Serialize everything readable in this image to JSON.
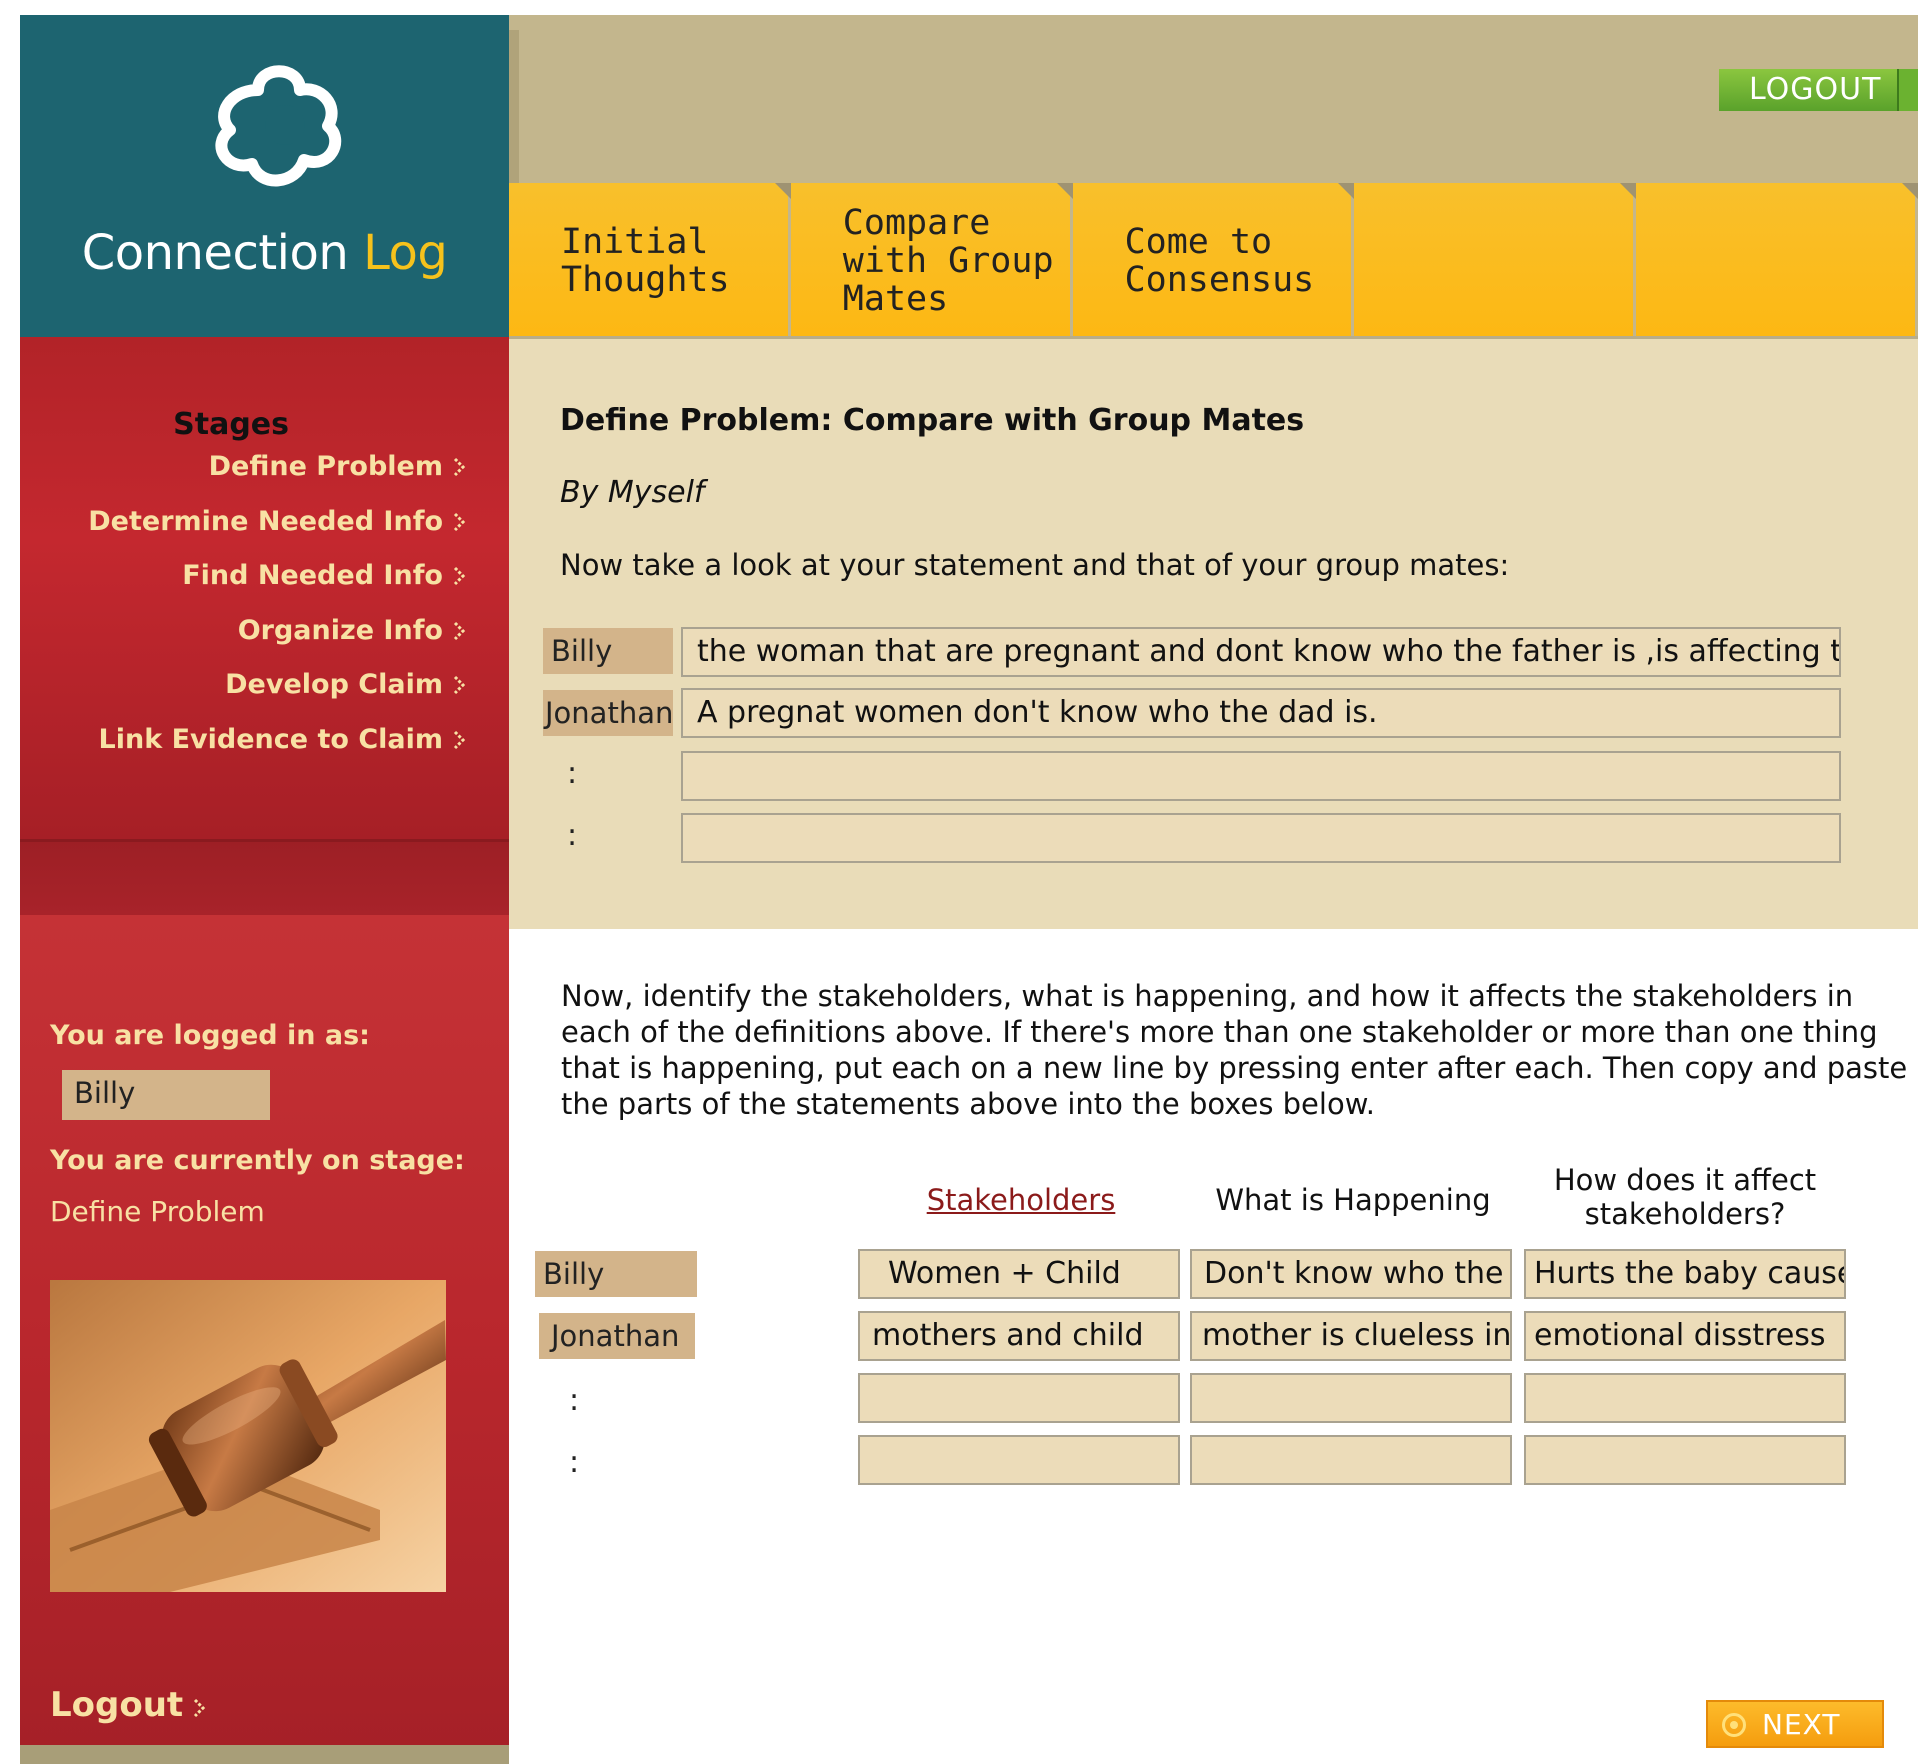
{
  "app": {
    "logo_text_main": "Connection ",
    "logo_text_accent": "Log"
  },
  "header": {
    "logout_label": "LOGOUT"
  },
  "tabs": [
    {
      "label_lines": [
        "Initial",
        "Thoughts"
      ]
    },
    {
      "label_lines": [
        "Compare",
        "with Group",
        "Mates"
      ]
    },
    {
      "label_lines": [
        "Come to",
        "Consensus"
      ]
    },
    {
      "label_lines": []
    },
    {
      "label_lines": []
    }
  ],
  "sidebar": {
    "stages_heading": "Stages",
    "stages": [
      {
        "label": "Define Problem"
      },
      {
        "label": "Determine Needed Info"
      },
      {
        "label": "Find Needed Info"
      },
      {
        "label": "Organize Info"
      },
      {
        "label": "Develop Claim"
      },
      {
        "label": "Link Evidence to Claim"
      }
    ],
    "logged_in_label": "You are logged in as:",
    "user_name": "Billy",
    "current_stage_label": "You are currently on stage:",
    "current_stage": "Define Problem",
    "logout_label": "Logout"
  },
  "main": {
    "title": "Define Problem: Compare with Group Mates",
    "subtitle": "By Myself",
    "intro": "Now take a look at your statement and that of your group mates:",
    "statements": [
      {
        "name": "Billy",
        "text": "the woman that are pregnant and dont know who the father is ,is affecting the"
      },
      {
        "name": "Jonathan",
        "text": "A pregnat women don't know who the dad is."
      },
      {
        "name": ":",
        "text": ""
      },
      {
        "name": ":",
        "text": ""
      }
    ],
    "instructions": "Now, identify the stakeholders, what is happening, and how it affects the stakeholders in each of the definitions above. If there's more than one stakeholder or more than one thing that is happening, put each on a new line by pressing enter after each. Then copy and paste the parts of the statements above into the boxes below.",
    "columns": {
      "stakeholders": "Stakeholders",
      "happening": "What is Happening",
      "affect": "How does it affect stakeholders?"
    },
    "rows": [
      {
        "name": "Billy",
        "stakeholders": "Women + Child",
        "happening": "Don't know who the",
        "affect": "Hurts the baby cause"
      },
      {
        "name": "Jonathan",
        "stakeholders": "mothers and child",
        "happening": "mother is clueless in",
        "affect": "emotional disstress"
      },
      {
        "name": ":",
        "stakeholders": "",
        "happening": "",
        "affect": ""
      },
      {
        "name": ":",
        "stakeholders": "",
        "happening": "",
        "affect": ""
      }
    ],
    "next_label": "NEXT"
  },
  "colors": {
    "sidebar_teal": "#1d6470",
    "sidebar_red": "#b9272d",
    "tab_yellow": "#fdb813",
    "header_tan": "#c3b68d",
    "accent_gold": "#f6c21c",
    "logout_green": "#6bb230",
    "next_orange": "#f59d0e"
  },
  "icons": {
    "logo": "trefoil-logo-icon",
    "stage_arrow": "chevron-right-icon",
    "gavel": "gavel-image",
    "next": "circle-next-icon"
  }
}
